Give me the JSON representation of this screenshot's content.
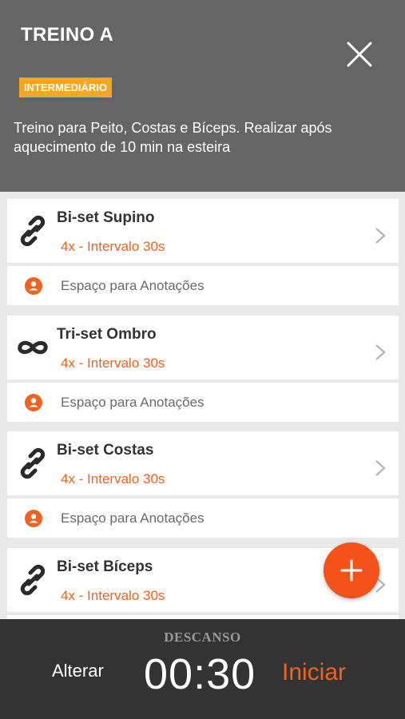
{
  "header": {
    "title": "TREINO A",
    "badge": "INTERMEDIÁRIO",
    "description": "Treino para Peito, Costas e Bíceps. Realizar após aquecimento de 10 min na esteira"
  },
  "exercises": [
    {
      "name": "Bi-set Supino",
      "sets": "4x - Intervalo 30s",
      "note": "Espaço para Anotações",
      "icon": "link-icon"
    },
    {
      "name": "Tri-set Ombro",
      "sets": "4x - Intervalo 30s",
      "note": "Espaço para Anotações",
      "icon": "infinity-icon"
    },
    {
      "name": "Bi-set Costas",
      "sets": "4x - Intervalo 30s",
      "note": "Espaço para Anotações",
      "icon": "link-icon"
    },
    {
      "name": "Bi-set Bíceps",
      "sets": "4x - Intervalo 30s",
      "icon": "link-icon"
    }
  ],
  "rest": {
    "label": "DESCANSO",
    "change_label": "Alterar",
    "time": "00:30",
    "start_label": "Iniciar"
  },
  "colors": {
    "header_bg": "#656565",
    "accent": "#f0621f",
    "badge": "#f5a623",
    "bottom_bg": "#333333"
  }
}
